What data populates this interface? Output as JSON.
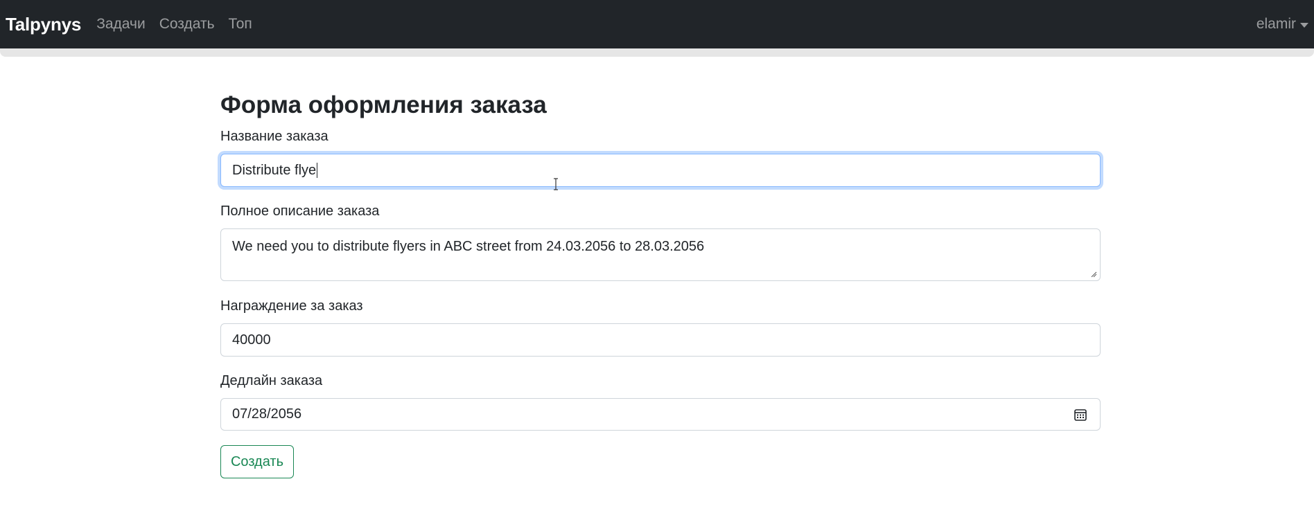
{
  "navbar": {
    "brand": "Talpynys",
    "links": [
      "Задачи",
      "Создать",
      "Топ"
    ],
    "user": "elamir"
  },
  "form": {
    "title": "Форма оформления заказа",
    "name_label": "Название заказа",
    "name_value": "Distribute flye",
    "description_label": "Полное описание заказа",
    "description_value": "We need you to distribute flyers in ABC street from 24.03.2056 to 28.03.2056",
    "reward_label": "Награждение за заказ",
    "reward_value": "40000",
    "deadline_label": "Дедлайн заказа",
    "deadline_value": "07/28/2056",
    "submit_label": "Создать"
  },
  "colors": {
    "navbar_bg": "#212529",
    "focus_border": "#86b7fe",
    "success": "#198754"
  },
  "icons": [
    "calendar-icon",
    "text-cursor-icon",
    "resize-grip-icon",
    "caret-down-icon"
  ]
}
